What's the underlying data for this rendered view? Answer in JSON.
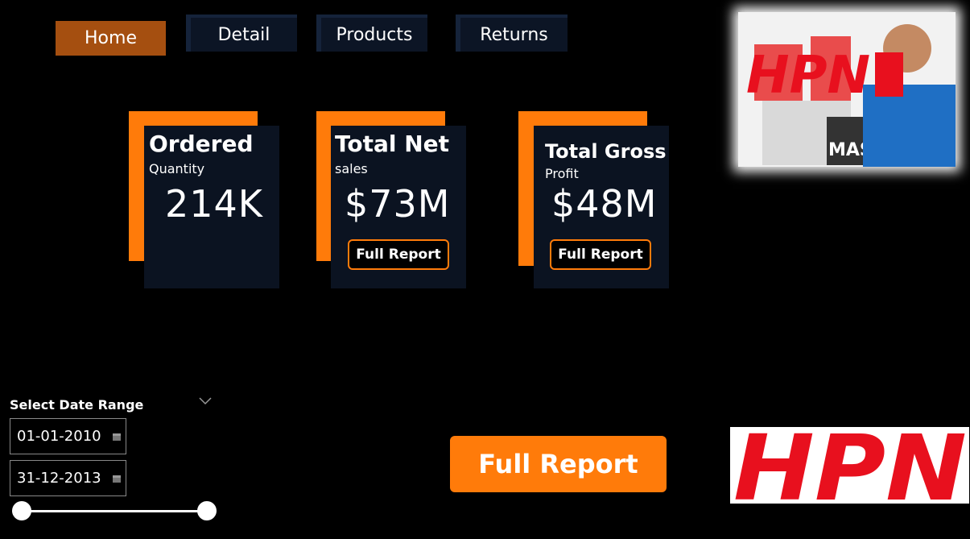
{
  "nav": {
    "tabs": [
      {
        "label": "Home",
        "active": true
      },
      {
        "label": "Detail",
        "active": false
      },
      {
        "label": "Products",
        "active": false
      },
      {
        "label": "Returns",
        "active": false
      }
    ]
  },
  "kpis": [
    {
      "title": "Ordered",
      "subtitle": "Quantity",
      "value": "214K"
    },
    {
      "title": "Total Net",
      "subtitle": "sales",
      "value": "$73M",
      "button": "Full Report"
    },
    {
      "title": "Total Gross",
      "subtitle": "Profit",
      "value": "$48M",
      "button": "Full Report"
    }
  ],
  "filter": {
    "label": "Select Date Range",
    "start": "01-01-2010",
    "end": "31-12-2013"
  },
  "main_button": "Full Report",
  "brand": {
    "logo_text": "HPN",
    "hero_logo_text": "HPN",
    "hero_product_text": "MASS"
  },
  "colors": {
    "accent": "#ff7b0a",
    "card": "#0b1321",
    "active_tab": "#a54f10",
    "logo_red": "#e8101e"
  }
}
